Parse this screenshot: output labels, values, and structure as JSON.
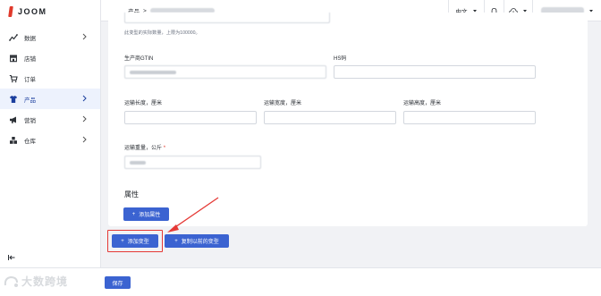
{
  "app": {
    "brand": "JOOM"
  },
  "sidebar": {
    "items": [
      {
        "label": "数据",
        "icon": "chart-line-icon",
        "has_children": true
      },
      {
        "label": "店铺",
        "icon": "store-icon",
        "has_children": false
      },
      {
        "label": "订单",
        "icon": "cart-icon",
        "has_children": false
      },
      {
        "label": "产品",
        "icon": "shirt-icon",
        "has_children": true,
        "active": true
      },
      {
        "label": "营销",
        "icon": "megaphone-icon",
        "has_children": true
      },
      {
        "label": "仓库",
        "icon": "warehouse-icon",
        "has_children": true
      }
    ]
  },
  "topbar": {
    "breadcrumb_root": "产品",
    "breadcrumb_sep": ">",
    "language": "中文"
  },
  "form": {
    "quantity_hint": "此变型的实际数量，上限为100000。",
    "gtin_label": "生产商GTIN",
    "hs_label": "HS码",
    "length_label": "运输长度，厘米",
    "width_label": "运输宽度，厘米",
    "height_label": "运输高度，厘米",
    "weight_label": "运输重量，公斤",
    "required_mark": "*",
    "attributes_title": "属性",
    "add_attribute": "添加属性",
    "add_variant": "添加变型",
    "copy_variant": "复制以前的变型",
    "button_plus": "+"
  },
  "footer": {
    "save": "保存",
    "watermark": "大数跨境"
  },
  "colors": {
    "primary": "#3b63d1",
    "brand_red": "#e0392b",
    "highlight": "#e53935"
  }
}
